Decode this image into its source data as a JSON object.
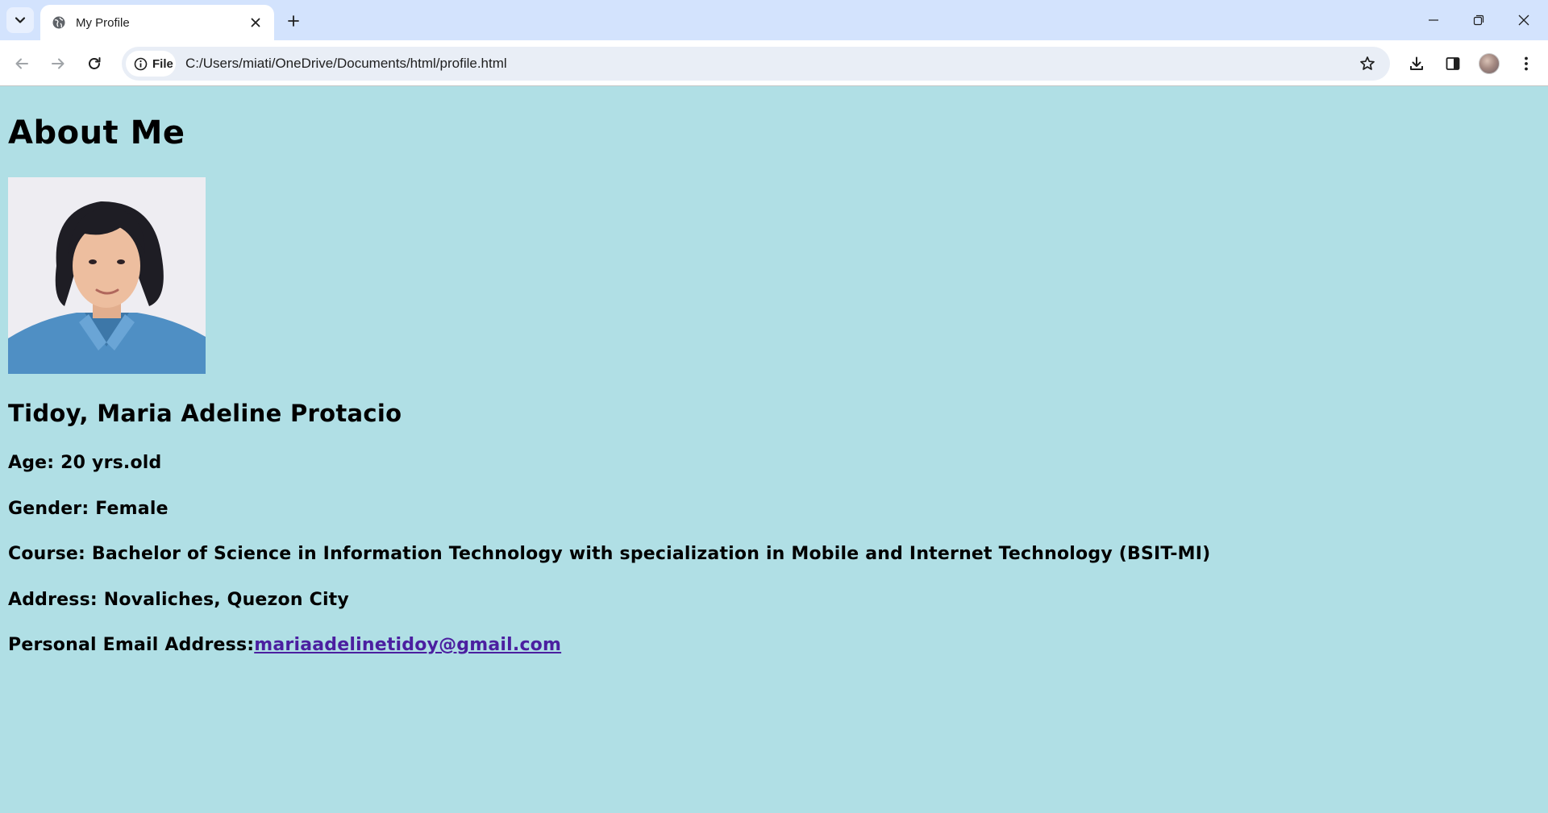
{
  "browser": {
    "tab_title": "My Profile",
    "address_chip": "File",
    "url": "C:/Users/miati/OneDrive/Documents/html/profile.html"
  },
  "page": {
    "heading": "About Me",
    "name": "Tidoy, Maria Adeline Protacio",
    "age": "Age: 20 yrs.old",
    "gender": "Gender: Female",
    "course": "Course: Bachelor of Science in Information Technology with specialization in Mobile and Internet Technology (BSIT-MI)",
    "address": "Address: Novaliches, Quezon City",
    "email_label": "Personal Email Address:",
    "email": "mariaadelinetidoy@gmail.com"
  },
  "colors": {
    "page_background": "#b0dfe5",
    "tabstrip": "#d3e3fd",
    "link": "#4b1fa0"
  },
  "icons": {
    "tab_search": "chevron-down-icon",
    "favicon": "globe-icon",
    "tab_close": "close-icon",
    "new_tab": "plus-icon",
    "minimize": "minimize-icon",
    "restore": "restore-icon",
    "window_close": "close-icon",
    "back": "back-arrow-icon",
    "forward": "forward-arrow-icon",
    "reload": "reload-icon",
    "site_info": "info-icon",
    "bookmark": "star-icon",
    "downloads": "download-icon",
    "side_panel": "side-panel-icon",
    "menu": "kebab-menu-icon"
  }
}
